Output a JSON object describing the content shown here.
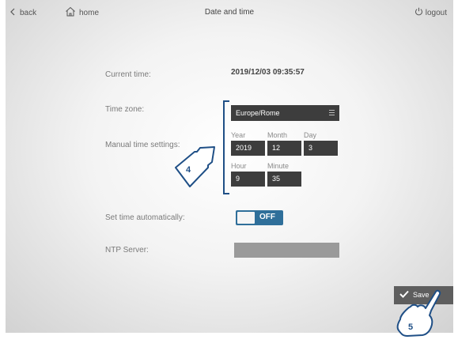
{
  "topbar": {
    "back_label": "back",
    "home_label": "home",
    "title": "Date and time",
    "logout_label": "logout"
  },
  "form": {
    "current_time_label": "Current time:",
    "current_time_value": "2019/12/03 09:35:57",
    "timezone_label": "Time zone:",
    "timezone_value": "Europe/Rome",
    "manual_label": "Manual time settings:",
    "year_label": "Year",
    "year_value": "2019",
    "month_label": "Month",
    "month_value": "12",
    "day_label": "Day",
    "day_value": "3",
    "hour_label": "Hour",
    "hour_value": "9",
    "minute_label": "Minute",
    "minute_value": "35",
    "auto_label": "Set time automatically:",
    "auto_toggle": "OFF",
    "ntp_label": "NTP Server:",
    "ntp_value": ""
  },
  "actions": {
    "save_label": "Save"
  },
  "callouts": {
    "step4": "4",
    "step5": "5"
  },
  "icons": {
    "back": "chevron-left-icon",
    "home": "home-icon",
    "logout": "power-icon",
    "save": "check-icon",
    "menu": "menu-lines-icon"
  },
  "colors": {
    "field_bg": "#3d3d3d",
    "toggle_bg": "#2f6f9a",
    "callout_blue": "#1f4f86",
    "save_bg": "#5e5e5e"
  }
}
